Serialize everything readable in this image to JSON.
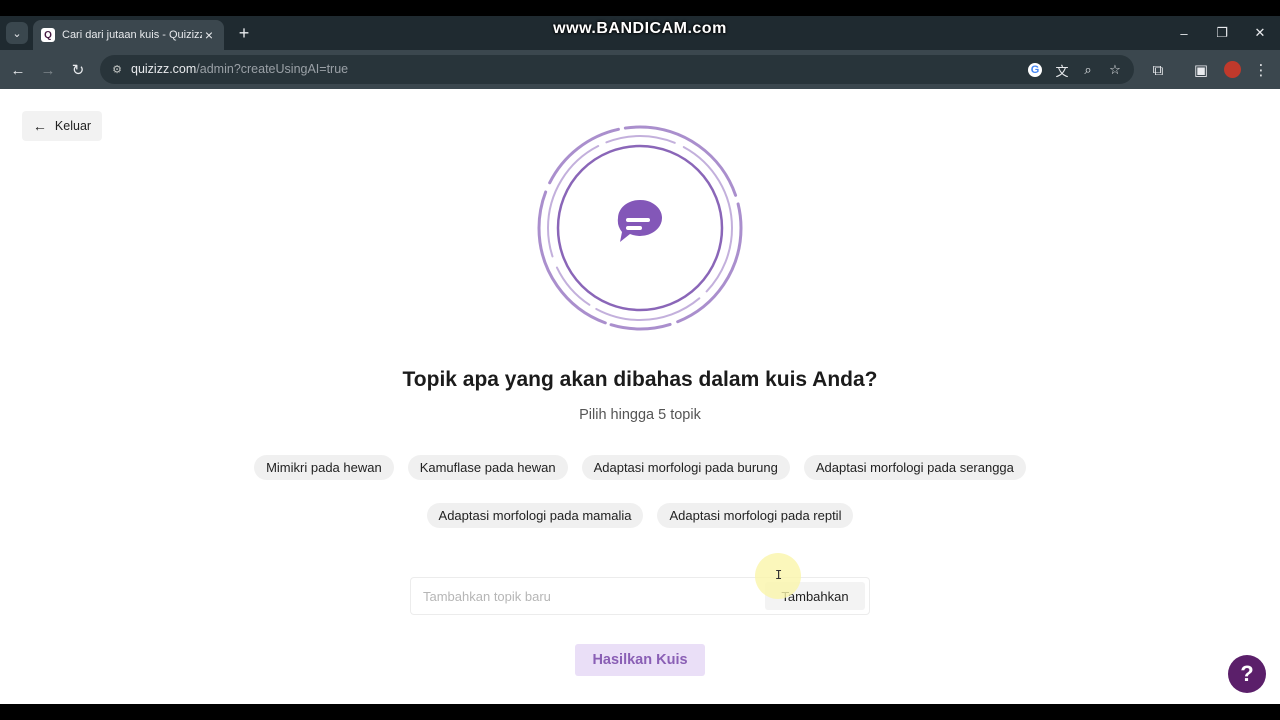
{
  "browser": {
    "tab_title": "Cari dari jutaan kuis - Quizizz",
    "tab_favicon": "Q",
    "url_host": "quizizz.com",
    "url_path": "/admin?createUsingAI=true",
    "watermark": "www.BANDICAM.com",
    "icons": {
      "tab_search": "chevron-down-icon",
      "close_tab": "close-icon",
      "new_tab": "plus-icon",
      "back": "arrow-left-icon",
      "forward": "arrow-right-icon",
      "reload": "reload-icon",
      "site_info": "tune-icon",
      "google": "google-icon",
      "translate": "translate-icon",
      "zoom": "zoom-icon",
      "bookmark": "star-icon",
      "extensions": "puzzle-icon",
      "side_panel": "sidepanel-icon",
      "menu": "kebab-icon"
    }
  },
  "page": {
    "back_label": "Keluar",
    "heading": "Topik apa yang akan dibahas dalam kuis Anda?",
    "subheading": "Pilih hingga 5 topik",
    "topics_row1": [
      "Mimikri pada hewan",
      "Kamuflase pada hewan",
      "Adaptasi morfologi pada burung",
      "Adaptasi morfologi pada serangga"
    ],
    "topics_row2": [
      "Adaptasi morfologi pada mamalia",
      "Adaptasi morfologi pada reptil"
    ],
    "topic_input_placeholder": "Tambahkan topik baru",
    "add_label": "Tambahkan",
    "generate_label": "Hasilkan Kuis",
    "help_label": "?"
  },
  "colors": {
    "brand_purple": "#8a5fb5",
    "hero_ring": "#9b7bc4",
    "generate_bg": "#eadff7",
    "help_bg": "#5b1f6a"
  }
}
